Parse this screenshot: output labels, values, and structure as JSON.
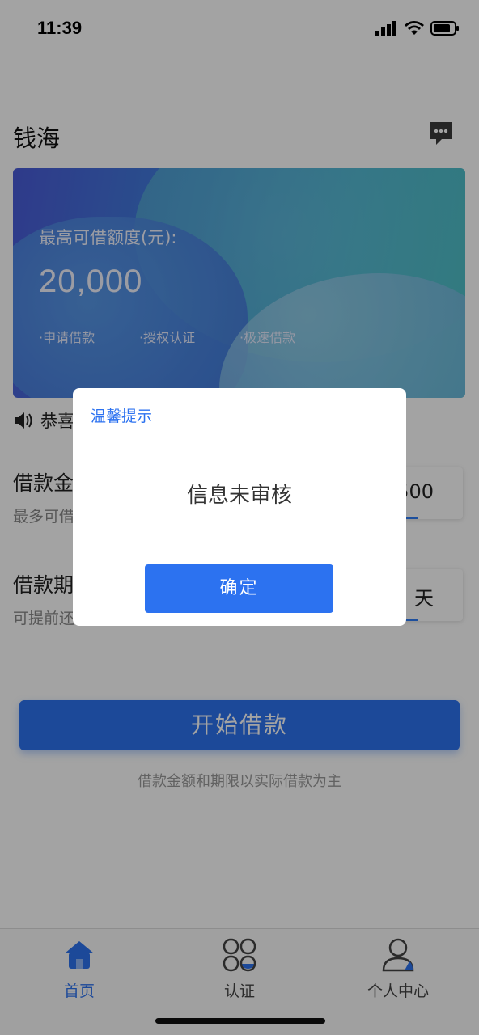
{
  "status": {
    "time": "11:39"
  },
  "header": {
    "title": "钱海"
  },
  "banner": {
    "label": "最高可借额度(元):",
    "amount": "20,000",
    "steps": [
      "·申请借款",
      "·授权认证",
      "·极速借款"
    ]
  },
  "notice": {
    "text": "恭喜"
  },
  "loan_amount": {
    "title": "借款金",
    "subtitle": "最多可借",
    "value": "500"
  },
  "loan_term": {
    "title": "借款期",
    "subtitle": "可提前还",
    "value": "天"
  },
  "start_button": {
    "label": "开始借款"
  },
  "footnote": "借款金额和期限以实际借款为主",
  "tabs": [
    {
      "label": "首页",
      "icon": "home-icon",
      "active": true
    },
    {
      "label": "认证",
      "icon": "verify-icon",
      "active": false
    },
    {
      "label": "个人中心",
      "icon": "user-icon",
      "active": false
    }
  ],
  "dialog": {
    "title": "温馨提示",
    "message": "信息未审核",
    "confirm_label": "确定"
  },
  "colors": {
    "accent": "#2c72f0",
    "overlay": "rgba(0,0,0,0.36)"
  }
}
